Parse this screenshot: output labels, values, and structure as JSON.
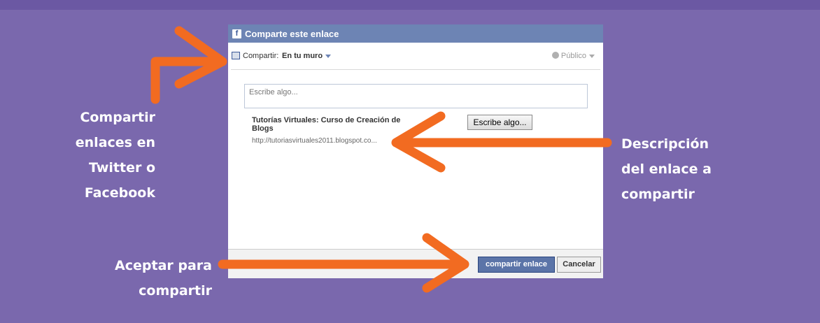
{
  "annotations": {
    "left": [
      "Compartir",
      "enlaces en",
      "Twitter o",
      "Facebook"
    ],
    "right": [
      "Descripción",
      "del enlace a",
      "compartir"
    ],
    "bottom": [
      "Aceptar para",
      "compartir"
    ]
  },
  "dialog": {
    "title": "Comparte este enlace",
    "share_label": "Compartir:",
    "share_target": "En tu muro",
    "privacy": "Público",
    "textarea_placeholder": "Escribe algo...",
    "link_title": "Tutorías Virtuales: Curso de Creación de Blogs",
    "link_url": "http://tutoriasvirtuales2011.blogspot.co...",
    "write_button": "Escribe algo...",
    "share_button": "compartir enlace",
    "cancel_button": "Cancelar"
  },
  "colors": {
    "background": "#7a68ad",
    "arrow": "#f26b21",
    "fb_header": "#6d84b4"
  }
}
